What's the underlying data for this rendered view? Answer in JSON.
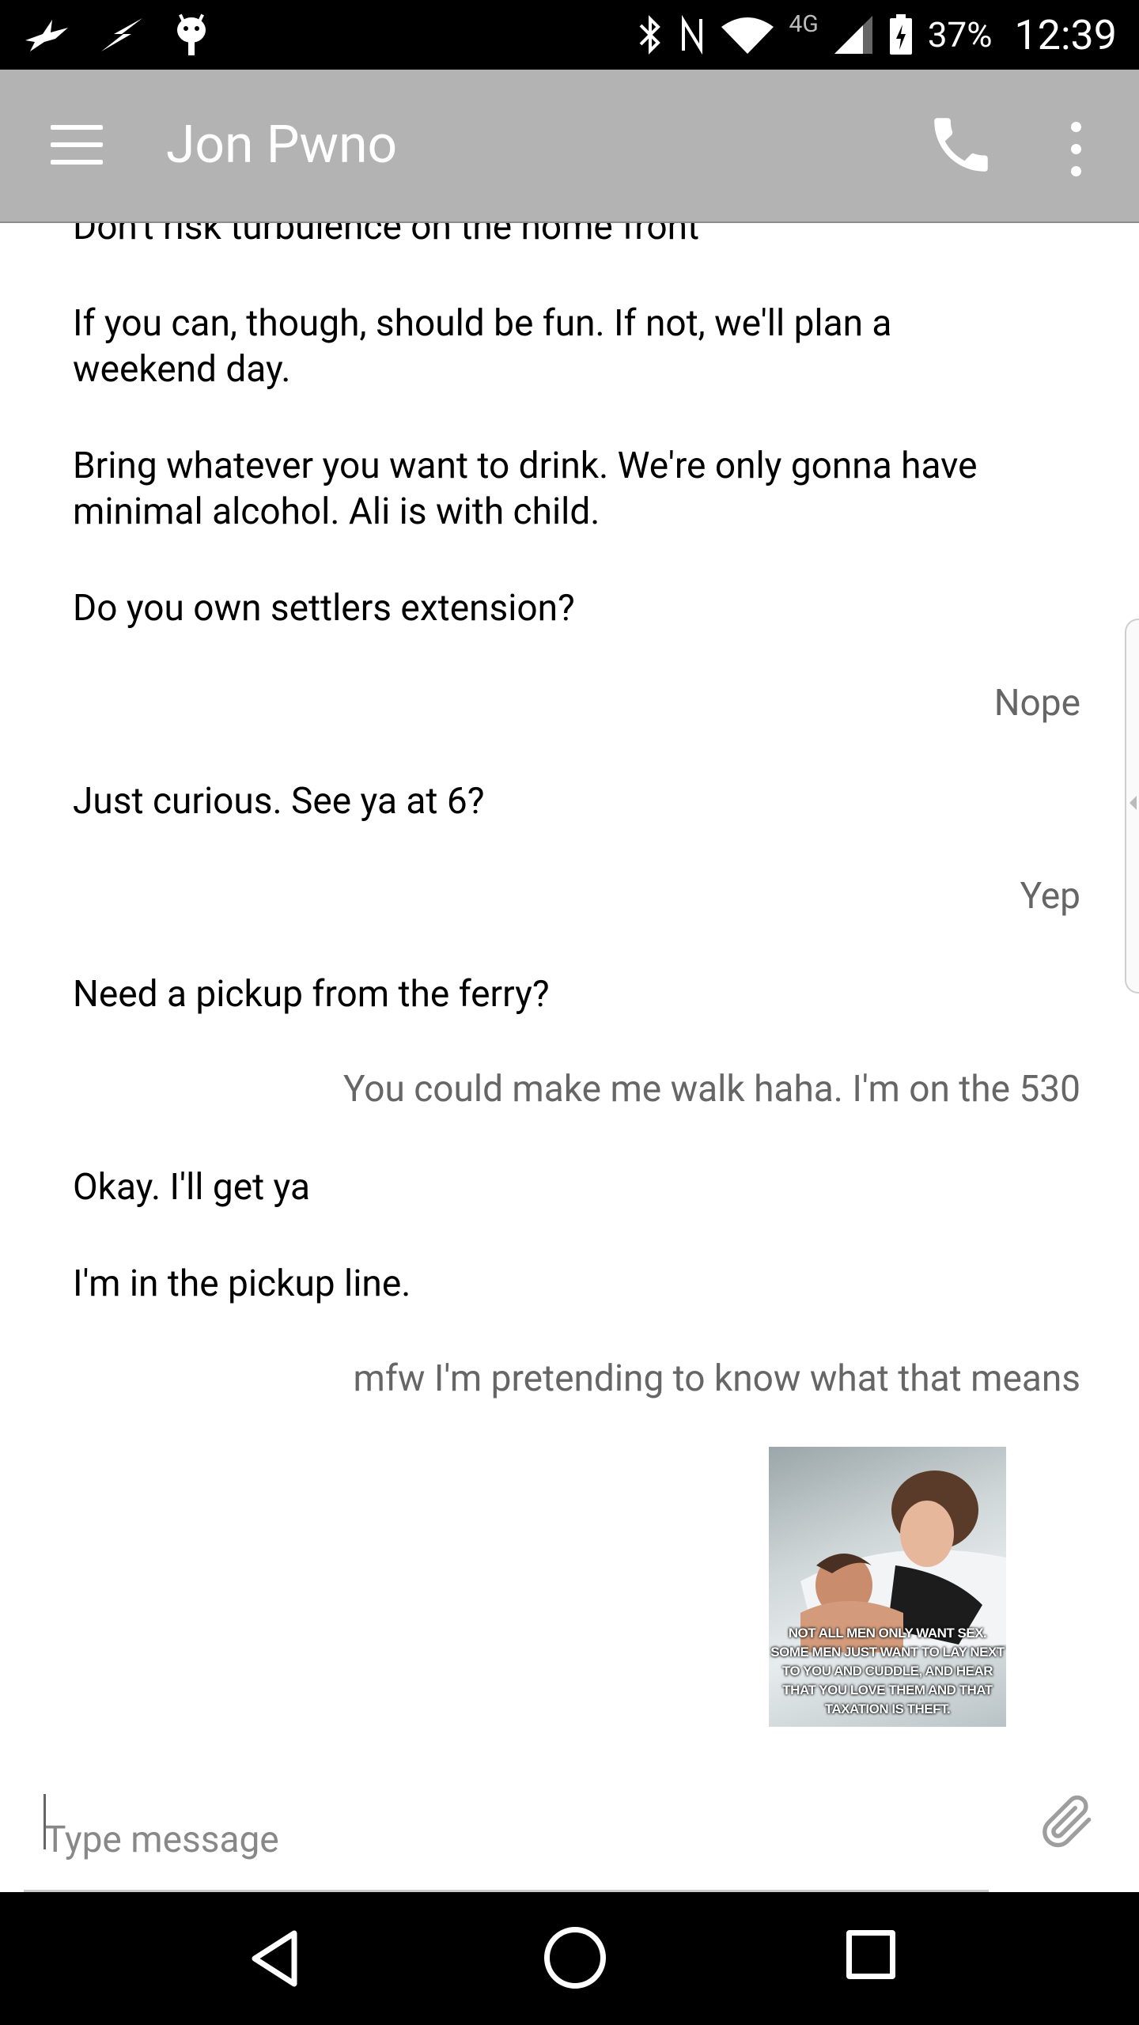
{
  "status_bar": {
    "battery": "37%",
    "network": "4G",
    "time": "12:39",
    "icons": [
      "bird-icon",
      "lightning-icon",
      "android-icon",
      "bluetooth-icon",
      "nfc-icon",
      "wifi-icon",
      "signal-icon",
      "battery-icon"
    ]
  },
  "app_bar": {
    "title": "Jon Pwno",
    "icons": [
      "menu-icon",
      "phone-icon",
      "more-vert-icon"
    ]
  },
  "messages": [
    {
      "direction": "in",
      "text": "Don't risk turbulence on the home front"
    },
    {
      "direction": "in",
      "text": "If you can, though, should be fun. If not, we'll plan a weekend day."
    },
    {
      "direction": "in",
      "text": "Bring whatever you want to drink. We're only gonna have minimal alcohol. Ali is with child."
    },
    {
      "direction": "in",
      "text": "Do you own settlers extension?"
    },
    {
      "direction": "out",
      "text": "Nope"
    },
    {
      "direction": "in",
      "text": "Just curious. See ya at 6?"
    },
    {
      "direction": "out",
      "text": "Yep"
    },
    {
      "direction": "in",
      "text": "Need a pickup from the ferry?"
    },
    {
      "direction": "out",
      "text": "You could make me walk haha. I'm on the 530"
    },
    {
      "direction": "in",
      "text": "Okay. I'll get ya"
    },
    {
      "direction": "in",
      "text": "I'm in the pickup line."
    },
    {
      "direction": "out",
      "text": "mfw I'm pretending to know what that means"
    }
  ],
  "image_message": {
    "caption": "NOT ALL MEN ONLY WANT SEX. SOME MEN JUST WANT TO LAY NEXT TO YOU AND CUDDLE, AND HEAR THAT YOU LOVE THEM AND THAT TAXATION IS THEFT."
  },
  "compose": {
    "placeholder": "Type message",
    "attach_icon": "paperclip-icon"
  },
  "nav_bar": {
    "icons": [
      "back-icon",
      "home-icon",
      "recents-icon"
    ]
  }
}
